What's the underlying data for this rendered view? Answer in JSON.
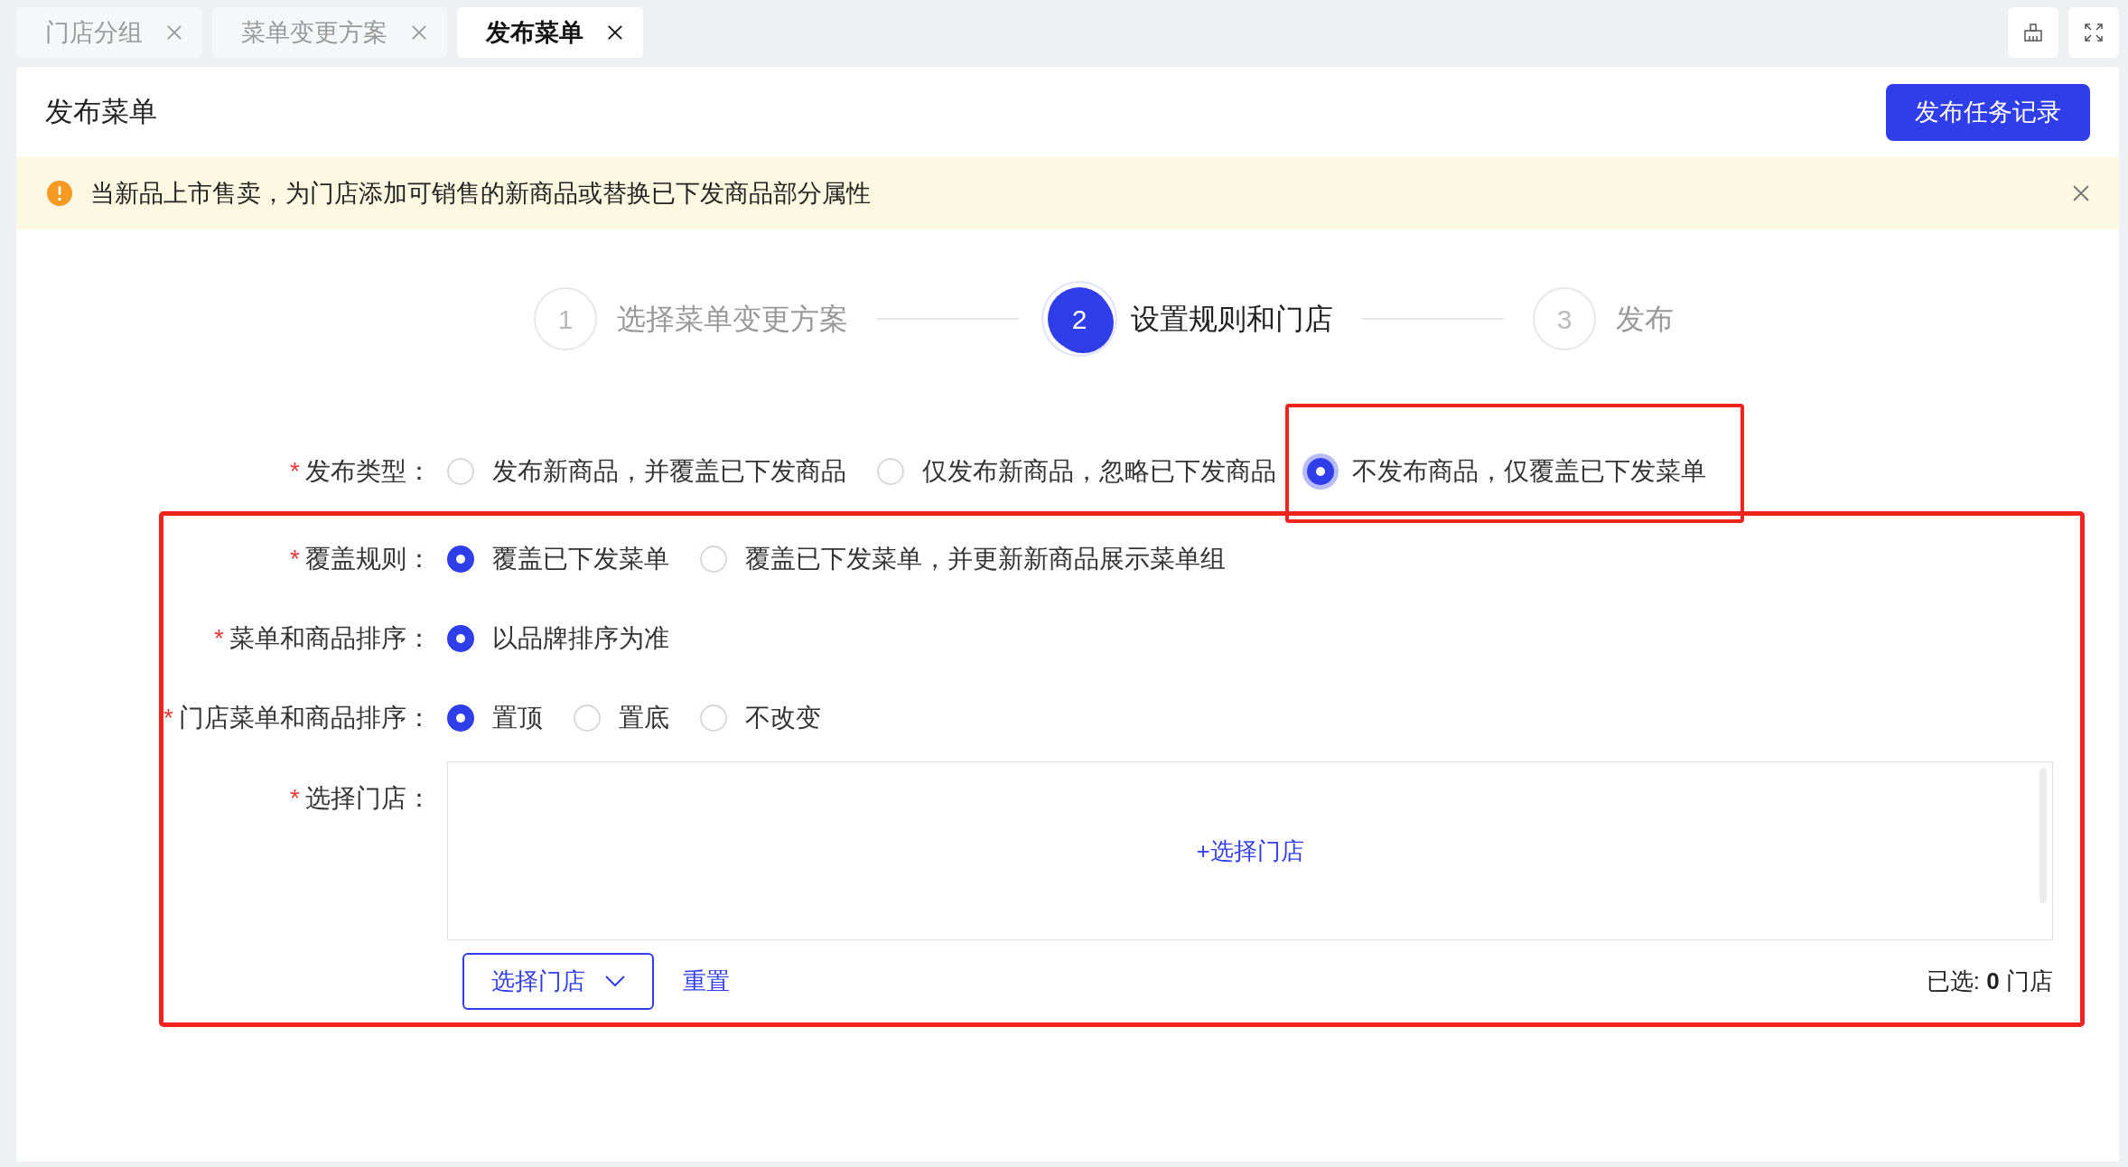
{
  "tabs": [
    {
      "label": "门店分组",
      "selected": false
    },
    {
      "label": "菜单变更方案",
      "selected": false
    },
    {
      "label": "发布菜单",
      "selected": true
    }
  ],
  "page": {
    "title": "发布菜单",
    "action_button": "发布任务记录"
  },
  "alert": {
    "text": "当新品上市售卖，为门店添加可销售的新商品或替换已下发商品部分属性",
    "dismissible": true
  },
  "steps": [
    {
      "number": "1",
      "label": "选择菜单变更方案",
      "active": false
    },
    {
      "number": "2",
      "label": "设置规则和门店",
      "active": true
    },
    {
      "number": "3",
      "label": "发布",
      "active": false
    }
  ],
  "publish_type": {
    "label": "发布类型：",
    "required_mark": "*",
    "options": [
      {
        "label": "发布新商品，并覆盖已下发商品",
        "selected": false,
        "highlighted": false,
        "focused": false
      },
      {
        "label": "仅发布新商品，忽略已下发商品",
        "selected": false,
        "highlighted": false,
        "focused": false
      },
      {
        "label": "不发布商品，仅覆盖已下发菜单",
        "selected": true,
        "highlighted": true,
        "focused": true
      }
    ]
  },
  "highlighted_group": {
    "highlighted": true,
    "fields": [
      {
        "label": "覆盖规则：",
        "required_mark": "*",
        "options": [
          {
            "label": "覆盖已下发菜单",
            "selected": true
          },
          {
            "label": "覆盖已下发菜单，并更新新商品展示菜单组",
            "selected": false
          }
        ]
      },
      {
        "label": "菜单和商品排序：",
        "required_mark": "*",
        "options": [
          {
            "label": "以品牌排序为准",
            "selected": true
          }
        ]
      },
      {
        "label": "门店菜单和商品排序：",
        "required_mark": "*",
        "options": [
          {
            "label": "置顶",
            "selected": true
          },
          {
            "label": "置底",
            "selected": false
          },
          {
            "label": "不改变",
            "selected": false
          }
        ]
      }
    ],
    "store_field": {
      "label": "选择门店：",
      "required_mark": "*",
      "add_link": "+选择门店",
      "select_button": "选择门店",
      "reset_link": "重置",
      "selected_count": "已选: **0** 门店"
    }
  }
}
